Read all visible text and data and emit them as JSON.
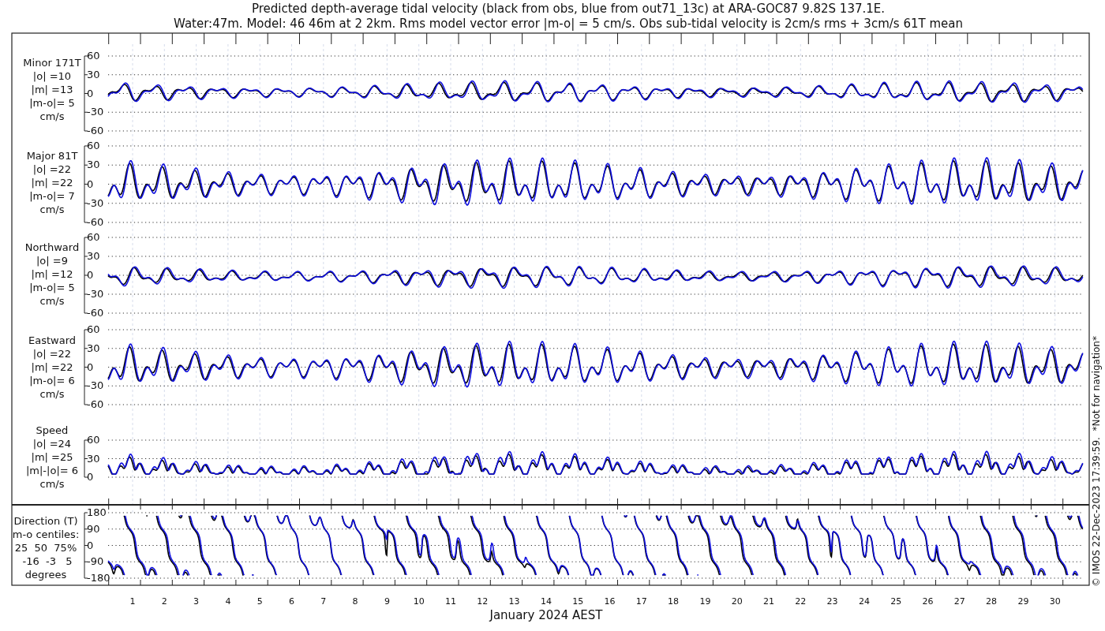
{
  "title_lines": [
    "Predicted depth-average tidal velocity (black from obs, blue from out71_13c) at ARA-GOC87 9.82S 137.1E.",
    "Water:47m. Model: 46 46m at 2 2km. Rms model vector error |m-o| = 5 cm/s. Obs sub-tidal velocity is 2cm/s rms + 3cm/s 61T mean"
  ],
  "panels": [
    {
      "kind": "minor",
      "label_lines": [
        "Minor 171T",
        "|o| =10",
        "|m| =13",
        "|m-o|= 5",
        "cm/s"
      ],
      "yticks": [
        "60",
        "30",
        "0",
        "-30",
        "-60"
      ]
    },
    {
      "kind": "major",
      "label_lines": [
        "Major 81T",
        "|o| =22",
        "|m| =22",
        "|m-o|= 7",
        "cm/s"
      ],
      "yticks": [
        "60",
        "30",
        "0",
        "-30",
        "-60"
      ]
    },
    {
      "kind": "northward",
      "label_lines": [
        "Northward",
        "|o| =9",
        "|m| =12",
        "|m-o|= 5",
        "cm/s"
      ],
      "yticks": [
        "60",
        "30",
        "0",
        "-30",
        "-60"
      ]
    },
    {
      "kind": "eastward",
      "label_lines": [
        "Eastward",
        "|o| =22",
        "|m| =22",
        "|m-o|= 6",
        "cm/s"
      ],
      "yticks": [
        "60",
        "30",
        "0",
        "-30",
        "-60"
      ]
    },
    {
      "kind": "speed",
      "label_lines": [
        "Speed",
        "|o| =24",
        "|m| =25",
        "|m|-|o|= 6",
        "cm/s"
      ],
      "yticks": [
        "60",
        "30",
        "0"
      ]
    },
    {
      "kind": "direction",
      "label_lines": [
        "Direction (T)",
        "m-o centiles:",
        "25  50  75%",
        " -16  -3   5",
        "degrees"
      ],
      "yticks": [
        "180",
        "90",
        "0",
        "-90",
        "-180"
      ]
    }
  ],
  "day_labels": [
    "1",
    "2",
    "3",
    "4",
    "5",
    "6",
    "7",
    "8",
    "9",
    "10",
    "11",
    "12",
    "13",
    "14",
    "15",
    "16",
    "17",
    "18",
    "19",
    "20",
    "21",
    "22",
    "23",
    "24",
    "25",
    "26",
    "27",
    "28",
    "29",
    "30"
  ],
  "xlabel": "January 2024 AEST",
  "credit": "© IMOS 22-Dec-2023 17:39:59.  *Not for navigation*"
}
